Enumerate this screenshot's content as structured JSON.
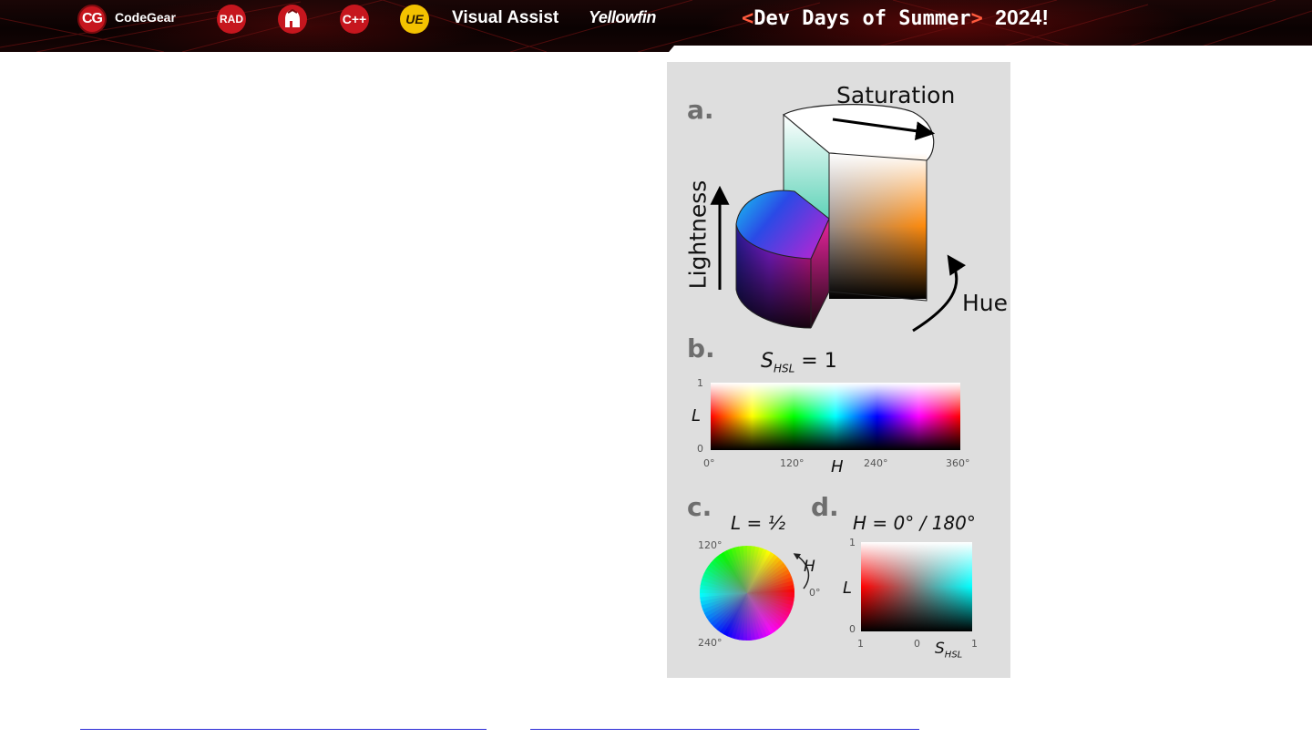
{
  "banner": {
    "logos": [
      {
        "icon": "codegear-logo-icon",
        "mark": "CG",
        "text": "CodeGear"
      },
      {
        "icon": "rad-logo-icon",
        "mark": "RAD"
      },
      {
        "icon": "spartan-helmet-logo-icon",
        "mark": ""
      },
      {
        "icon": "cpp-builder-logo-icon",
        "mark": "C++"
      },
      {
        "icon": "ue-logo-icon",
        "mark": "UE"
      },
      {
        "icon": "visual-assist-logo-icon",
        "text": "Visual Assist"
      },
      {
        "icon": "yellowfin-logo-icon",
        "text": "Yellowfin"
      }
    ],
    "event": {
      "open": "<",
      "name": "Dev Days of Summer",
      "close": ">",
      "year": "2024!"
    },
    "colors": {
      "accent": "#ff5a3d",
      "brand_red": "#c6161e",
      "brand_yellow": "#f3c200"
    }
  },
  "figure": {
    "a": {
      "letter": "a.",
      "saturation": "Saturation",
      "lightness": "Lightness",
      "hue": "Hue"
    },
    "b": {
      "letter": "b.",
      "title_s": "S",
      "title_sub": "HSL",
      "title_eq": " = 1",
      "y_label": "L",
      "y_top": "1",
      "y_bottom": "0",
      "x_label": "H",
      "x_ticks": [
        "0°",
        "120°",
        "240°",
        "360°"
      ]
    },
    "c": {
      "letter": "c.",
      "title": "L = ½",
      "h_label": "H",
      "tick_120": "120°",
      "tick_0": "0°",
      "tick_240": "240°"
    },
    "d": {
      "letter": "d.",
      "title": "H = 0° / 180°",
      "y_label": "L",
      "y_top": "1",
      "y_bottom": "0",
      "x_left": "1",
      "x_mid": "0",
      "x_right": "1",
      "x_label_s": "S",
      "x_label_sub": "HSL"
    }
  }
}
